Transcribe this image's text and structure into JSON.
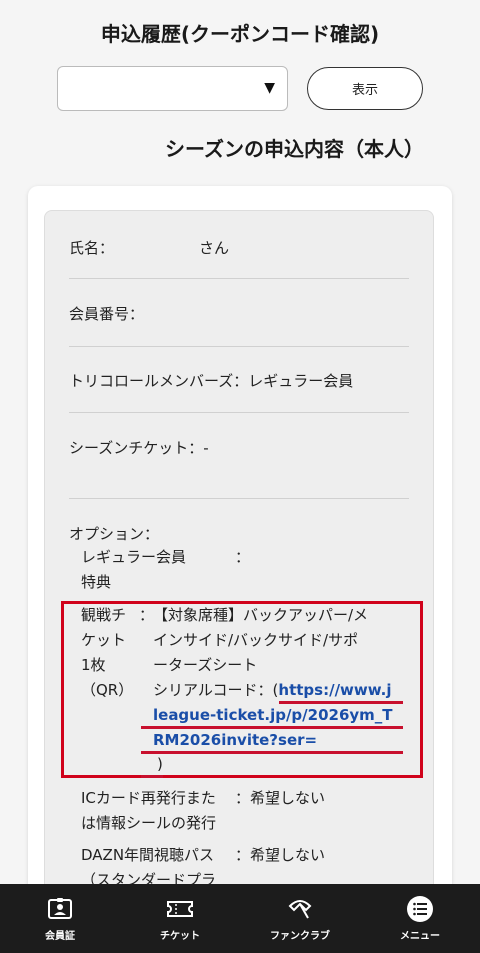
{
  "header": {
    "title": "申込履歴(クーポンコード確認)"
  },
  "controls": {
    "select_value": "",
    "select_arrow": "▼",
    "show_button": "表示"
  },
  "section": {
    "title": "シーズンの申込内容（本人）"
  },
  "fields": {
    "name_label": "氏名：",
    "name_value": "さん",
    "member_no_label": "会員番号：",
    "tricolore_label": "トリコロールメンバーズ：",
    "tricolore_value": "レギュラー会員",
    "season_ticket_label": "シーズンチケット：",
    "season_ticket_value": "-",
    "option_label": "オプション："
  },
  "option": {
    "regular_label_1": "レギュラー会員",
    "regular_label_2": "特典",
    "regular_colon": "：",
    "ticket_label_1": "観戦チ",
    "ticket_label_2": "ケット",
    "ticket_label_3": "1枚",
    "ticket_label_4": "（QR）",
    "ticket_colon": "：",
    "ticket_line_1": "【対象席種】バックアッパー/メ",
    "ticket_line_2": "インサイド/バックサイド/サポ",
    "ticket_line_3": "ーターズシート",
    "ticket_line_4_prefix": "シリアルコード：(",
    "ticket_link_1": "https://www.j",
    "ticket_link_2": "league-ticket.jp/p/2026ym_T",
    "ticket_link_3": "RM2026invite?ser=",
    "ticket_line_6": ")",
    "ic_label_1": "ICカード再発行また",
    "ic_label_2": "は情報シールの発行",
    "ic_value": "：希望しない",
    "dazn_label_1": "DAZN年間視聴パス",
    "dazn_label_2": "（スタンダードプラ",
    "dazn_value": "：希望しない"
  },
  "nav": [
    {
      "label": "会員証",
      "icon": "member-card-icon"
    },
    {
      "label": "チケット",
      "icon": "ticket-icon"
    },
    {
      "label": "ファンクラブ",
      "icon": "fanclub-icon"
    },
    {
      "label": "メニュー",
      "icon": "menu-icon"
    }
  ],
  "colors": {
    "nav_bg": "#1c1c1c",
    "highlight": "#d0021b",
    "link": "#1a4ea8"
  }
}
